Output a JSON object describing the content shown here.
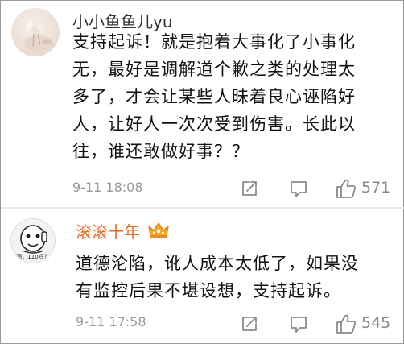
{
  "comments": [
    {
      "username": "小小鱼鱼儿yu",
      "lines": [
        "支持起诉！就是抱着大事化了小事化",
        "无，最好是调解道个歉之类的处理太",
        "多了，才会让某些人昧着良心诬陷好",
        "人，让好人一次次受到伤害。长此以",
        "往，谁还敢做好事？？"
      ],
      "time": "9-11 18:08",
      "likes": "571"
    },
    {
      "username": "滚滚十年",
      "avatar_caption": "嗯，110吗？",
      "lines": [
        "道德沦陷，讹人成本太低了，如果没",
        "有监控后果不堪设想，支持起诉。"
      ],
      "time": "9-11 17:58",
      "likes": "545"
    }
  ],
  "colors": {
    "username_default": "#333333",
    "username_highlight": "#f06a22",
    "meta_gray": "#999999",
    "icon_gray": "#8a8a8a"
  },
  "icons": [
    "share-icon",
    "comment-icon",
    "like-icon",
    "vip-crown-badge-icon"
  ]
}
